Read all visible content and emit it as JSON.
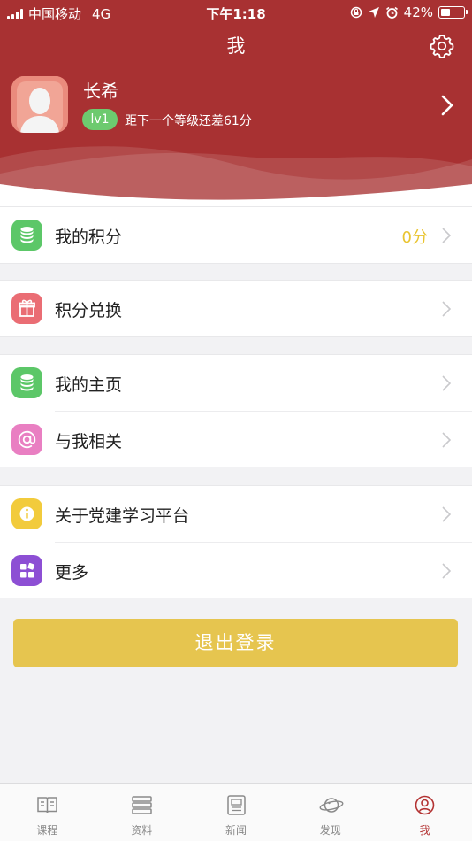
{
  "status_bar": {
    "carrier": "中国移动",
    "network": "4G",
    "time": "下午1:18",
    "battery": "42%",
    "battery_level": 0.42
  },
  "nav": {
    "title": "我",
    "settings_icon": "gear-icon"
  },
  "profile": {
    "name": "长希",
    "level": "lv1",
    "level_progress_text": "距下一个等级还差61分"
  },
  "menu_groups": [
    {
      "items": [
        {
          "label": "我的积分",
          "value": "0分",
          "icon": "coin-stack-icon",
          "color": "#5cc768"
        }
      ]
    },
    {
      "items": [
        {
          "label": "积分兑换",
          "icon": "gift-icon",
          "color": "#ea6d74"
        }
      ]
    },
    {
      "items": [
        {
          "label": "我的主页",
          "icon": "coin-stack-icon",
          "color": "#5cc768"
        },
        {
          "label": "与我相关",
          "icon": "at-icon",
          "color": "#e97fc2"
        }
      ]
    },
    {
      "items": [
        {
          "label": "关于党建学习平台",
          "icon": "info-icon",
          "color": "#f2cb3c"
        },
        {
          "label": "更多",
          "icon": "grid-icon",
          "color": "#8d4fd4"
        }
      ]
    }
  ],
  "logout_label": "退出登录",
  "tabs": [
    {
      "label": "课程",
      "icon": "book-icon"
    },
    {
      "label": "资料",
      "icon": "stack-icon"
    },
    {
      "label": "新闻",
      "icon": "newspaper-icon"
    },
    {
      "label": "发现",
      "icon": "planet-icon"
    },
    {
      "label": "我",
      "icon": "user-icon",
      "active": true
    }
  ],
  "colors": {
    "header": "#a83132",
    "accent": "#e6c54f",
    "active_tab": "#b33232"
  }
}
